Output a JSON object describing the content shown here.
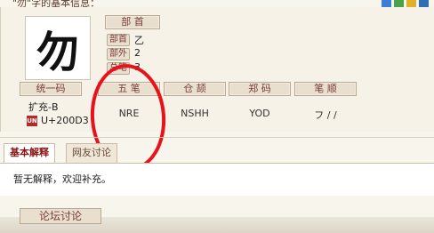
{
  "header": {
    "title": "\"勿\"字的基本信息："
  },
  "character": {
    "glyph": "勿"
  },
  "attributes": {
    "bushou_title": "部 首",
    "rows": [
      {
        "label": "部首",
        "value": "乙"
      },
      {
        "label": "部外",
        "value": "2"
      },
      {
        "label": "总笔",
        "value": "3"
      }
    ]
  },
  "codes": {
    "headers": [
      "统一码",
      "五 笔",
      "仓 颉",
      "郑 码",
      "笔 顺"
    ],
    "unified_block": "扩充-B",
    "unicode_badge": "UN",
    "unicode": "U+200D3",
    "wubi": "NRE",
    "cangjie": "NSHH",
    "zhengma": "YOD",
    "bishun": "フ / /"
  },
  "tabs": [
    {
      "label": "基本解释",
      "active": true
    },
    {
      "label": "网友讨论",
      "active": false
    }
  ],
  "content": {
    "text": "暂无解释，欢迎补充。"
  },
  "forum_button": {
    "label": "论坛讨论"
  },
  "colors": {
    "accent": "#7a3b3b",
    "annotation": "#e8121b"
  }
}
